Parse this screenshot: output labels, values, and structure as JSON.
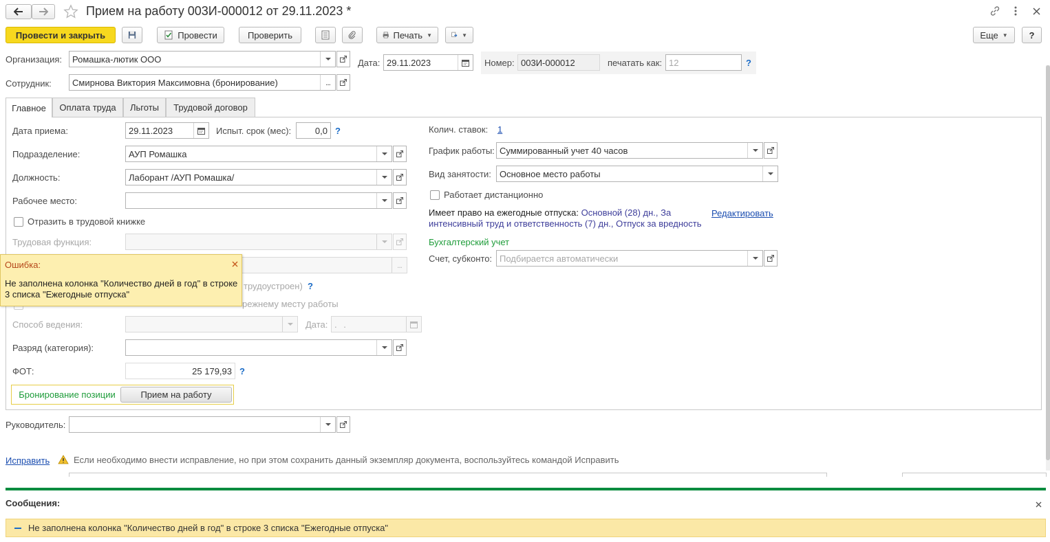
{
  "window": {
    "title": "Прием на работу 003И-000012 от 29.11.2023 *"
  },
  "toolbar": {
    "post_close": "Провести и закрыть",
    "post": "Провести",
    "check": "Проверить",
    "print": "Печать",
    "more": "Еще",
    "help": "?"
  },
  "header": {
    "org_label": "Организация:",
    "org_value": "Ромашка-лютик ООО",
    "date_label": "Дата:",
    "date_value": "29.11.2023",
    "number_label": "Номер:",
    "number_value": "003И-000012",
    "print_as_label": "печатать как:",
    "print_as_placeholder": "12",
    "employee_label": "Сотрудник:",
    "employee_value": "Смирнова Виктория Максимовна (бронирование)"
  },
  "tabs": [
    {
      "label": "Главное"
    },
    {
      "label": "Оплата труда"
    },
    {
      "label": "Льготы"
    },
    {
      "label": "Трудовой договор"
    }
  ],
  "main": {
    "hire_date_label": "Дата приема:",
    "hire_date_value": "29.11.2023",
    "probation_label": "Испыт. срок (мес):",
    "probation_value": "0,0",
    "department_label": "Подразделение:",
    "department_value": "АУП Ромашка",
    "position_label": "Должность:",
    "position_value": "Лаборант /АУП Ромашка/",
    "workplace_label": "Рабочее место:",
    "workplace_value": "",
    "workbook_label": "Отразить в трудовой книжке",
    "labor_function_label": "Трудовая функция:",
    "employed_fragment": "трудоустроен)",
    "prev_place_fragment": "режнему месту работы",
    "method_label": "Способ ведения:",
    "method_date_label": "Дата:",
    "method_date_value": ". .",
    "grade_label": "Разряд (категория):",
    "fot_label": "ФОТ:",
    "fot_value": "25 179,93",
    "rates_label": "Колич. ставок:",
    "rates_value": "1",
    "schedule_label": "График работы:",
    "schedule_value": "Суммированный учет 40 часов",
    "employment_label": "Вид занятости:",
    "employment_value": "Основное место работы",
    "remote_label": "Работает дистанционно",
    "vacation_label": "Имеет право на ежегодные отпуска:",
    "vacation_line1": "Основной (28) дн., За",
    "vacation_line2": "интенсивный труд и ответственность (7) дн., Отпуск за вредность",
    "edit_link": "Редактировать",
    "accounting_title": "Бухгалтерский учет",
    "account_label": "Счет, субконто:",
    "account_placeholder": "Подбирается автоматически",
    "switch_reserve": "Бронирование позиции",
    "switch_hire": "Прием на работу"
  },
  "manager": {
    "label": "Руководитель:",
    "value": ""
  },
  "fix": {
    "link": "Исправить",
    "text": "Если необходимо внести исправление, но при этом сохранить данный экземпляр документа, воспользуйтесь командой Исправить"
  },
  "error_popup": {
    "title": "Ошибка:",
    "text": "Не заполнена колонка \"Количество дней в год\" в строке 3 списка \"Ежегодные отпуска\""
  },
  "messages": {
    "title": "Сообщения:",
    "items": [
      {
        "text": "Не заполнена колонка \"Количество дней в год\" в строке 3 списка \"Ежегодные отпуска\""
      }
    ]
  },
  "colors": {
    "primary_button": "#f7d81e",
    "messages_bar": "#0a8c3f",
    "message_bg": "#fbe8a6",
    "popup_bg": "#fdefb0",
    "link": "#1a4db0",
    "accounting_green": "#1e9c3a"
  }
}
